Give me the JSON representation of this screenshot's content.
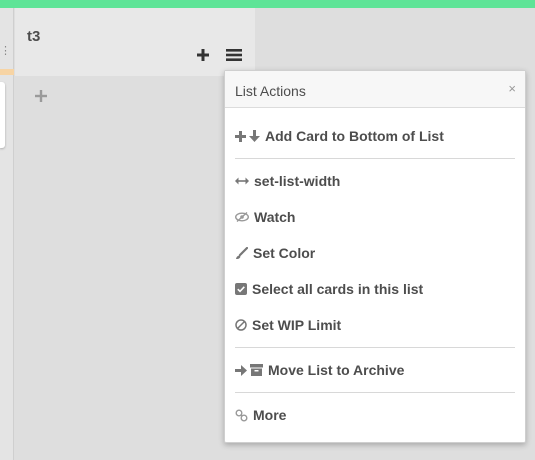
{
  "list": {
    "title": "t3"
  },
  "popup": {
    "title": "List Actions",
    "close_glyph": "×",
    "items": [
      {
        "label": "Add Card to Bottom of List",
        "icons": [
          "plus-icon",
          "arrow-down-icon"
        ]
      },
      {
        "label": "set-list-width",
        "icons": [
          "arrows-horizontal-icon"
        ]
      },
      {
        "label": "Watch",
        "icons": [
          "eye-slash-icon"
        ]
      },
      {
        "label": "Set Color",
        "icons": [
          "paint-brush-icon"
        ]
      },
      {
        "label": "Select all cards in this list",
        "icons": [
          "check-square-icon"
        ]
      },
      {
        "label": "Set WIP Limit",
        "icons": [
          "ban-icon"
        ]
      },
      {
        "label": "Move List to Archive",
        "icons": [
          "arrow-right-icon",
          "archive-icon"
        ]
      },
      {
        "label": "More",
        "icons": [
          "link-icon"
        ]
      }
    ]
  },
  "colors": {
    "top_bar": "#5ee497",
    "background": "#dedede",
    "list_header": "#e8e8e8",
    "text": "#4d4d4d"
  }
}
